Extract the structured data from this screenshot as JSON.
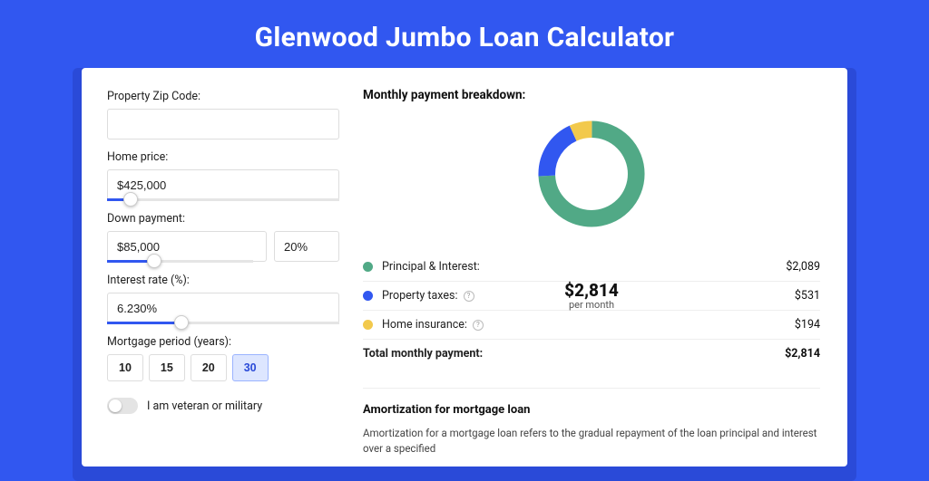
{
  "title": "Glenwood Jumbo Loan Calculator",
  "left": {
    "zip_label": "Property Zip Code:",
    "zip_value": "",
    "home_price_label": "Home price:",
    "home_price_value": "$425,000",
    "down_payment_label": "Down payment:",
    "down_payment_value": "$85,000",
    "down_payment_pct": "20%",
    "rate_label": "Interest rate (%):",
    "rate_value": "6.230%",
    "period_label": "Mortgage period (years):",
    "periods": [
      "10",
      "15",
      "20",
      "30"
    ],
    "period_active_index": 3,
    "veteran_label": "I am veteran or military"
  },
  "breakdown": {
    "heading": "Monthly payment breakdown:",
    "center_amount": "$2,814",
    "center_sub": "per month",
    "rows": [
      {
        "color": "#51a986",
        "label": "Principal & Interest:",
        "value": "$2,089",
        "info": false
      },
      {
        "color": "#3157f0",
        "label": "Property taxes:",
        "value": "$531",
        "info": true
      },
      {
        "color": "#f2c94c",
        "label": "Home insurance:",
        "value": "$194",
        "info": true
      }
    ],
    "total_label": "Total monthly payment:",
    "total_value": "$2,814"
  },
  "amort": {
    "heading": "Amortization for mortgage loan",
    "text": "Amortization for a mortgage loan refers to the gradual repayment of the loan principal and interest over a specified"
  },
  "chart_data": {
    "type": "pie",
    "title": "Monthly payment breakdown",
    "series": [
      {
        "name": "Principal & Interest",
        "value": 2089,
        "color": "#51a986"
      },
      {
        "name": "Property taxes",
        "value": 531,
        "color": "#3157f0"
      },
      {
        "name": "Home insurance",
        "value": 194,
        "color": "#f2c94c"
      }
    ],
    "total": 2814,
    "center_label": "$2,814 per month"
  }
}
